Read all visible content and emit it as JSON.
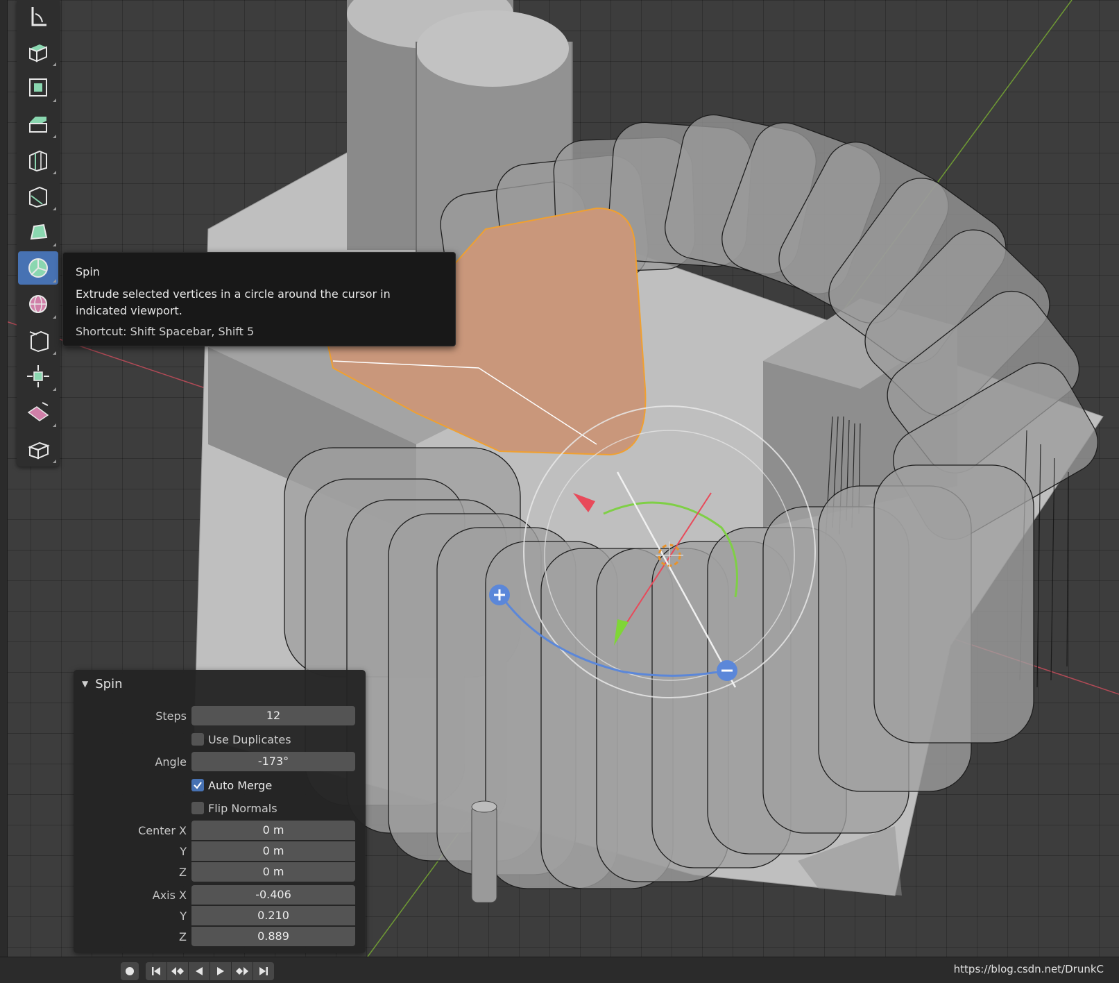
{
  "toolbar": {
    "tools": [
      {
        "icon": "measure-icon"
      },
      {
        "icon": "extrude-region-icon"
      },
      {
        "icon": "inset-faces-icon"
      },
      {
        "icon": "bevel-icon"
      },
      {
        "icon": "loop-cut-icon"
      },
      {
        "icon": "knife-icon"
      },
      {
        "icon": "poly-build-icon"
      },
      {
        "icon": "spin-icon",
        "active": true
      },
      {
        "icon": "smooth-icon"
      },
      {
        "icon": "edge-slide-icon"
      },
      {
        "icon": "shrink-fatten-icon"
      },
      {
        "icon": "shear-icon"
      },
      {
        "icon": "rip-region-icon"
      }
    ]
  },
  "tooltip": {
    "title": "Spin",
    "description": "Extrude selected vertices in a circle around the cursor in indicated viewport.",
    "shortcut": "Shortcut: Shift Spacebar, Shift 5"
  },
  "panel": {
    "title": "Spin",
    "steps_label": "Steps",
    "steps": "12",
    "use_duplicates_label": "Use Duplicates",
    "use_duplicates": false,
    "angle_label": "Angle",
    "angle": "-173°",
    "auto_merge_label": "Auto Merge",
    "auto_merge": true,
    "flip_normals_label": "Flip Normals",
    "flip_normals": false,
    "center_x_label": "Center X",
    "center_x": "0 m",
    "center_y_label": "Y",
    "center_y": "0 m",
    "center_z_label": "Z",
    "center_z": "0 m",
    "axis_x_label": "Axis X",
    "axis_x": "-0.406",
    "axis_y_label": "Y",
    "axis_y": "0.210",
    "axis_z_label": "Z",
    "axis_z": "0.889"
  },
  "timeline": {
    "record_icon": "record-icon",
    "buttons": [
      "jump-start-icon",
      "prev-keyframe-icon",
      "play-reverse-icon",
      "play-icon",
      "next-keyframe-icon",
      "jump-end-icon"
    ],
    "watermark": "https://blog.csdn.net/DrunkC"
  },
  "colors": {
    "accent": "#4772b3",
    "selection": "#e8922a",
    "x_axis": "#d5485a",
    "y_axis": "#7fb83a",
    "gizmo_blue": "#5b87d9"
  }
}
